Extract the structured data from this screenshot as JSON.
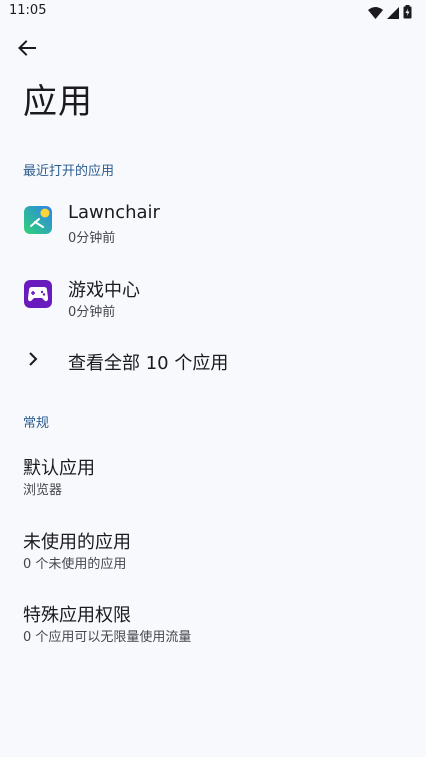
{
  "status_bar": {
    "time": "11:05",
    "icons": [
      "wifi-icon",
      "signal-icon",
      "battery-icon"
    ]
  },
  "header": {
    "back_icon": "arrow-back-icon",
    "title": "应用"
  },
  "recent": {
    "header": "最近打开的应用",
    "apps": [
      {
        "name": "Lawnchair",
        "time": "0分钟前",
        "icon": "lawnchair-icon"
      },
      {
        "name": "游戏中心",
        "time": "0分钟前",
        "icon": "game-center-icon"
      }
    ],
    "see_all": "查看全部 10 个应用"
  },
  "general": {
    "header": "常规",
    "items": [
      {
        "title": "默认应用",
        "subtitle": "浏览器"
      },
      {
        "title": "未使用的应用",
        "subtitle": "0 个未使用的应用"
      },
      {
        "title": "特殊应用权限",
        "subtitle": "0 个应用可以无限量使用流量"
      }
    ]
  },
  "colors": {
    "background": "#f8f9fc",
    "section_header": "#2b5c8f",
    "text": "#1b1b1f",
    "subtext": "#44474e"
  }
}
